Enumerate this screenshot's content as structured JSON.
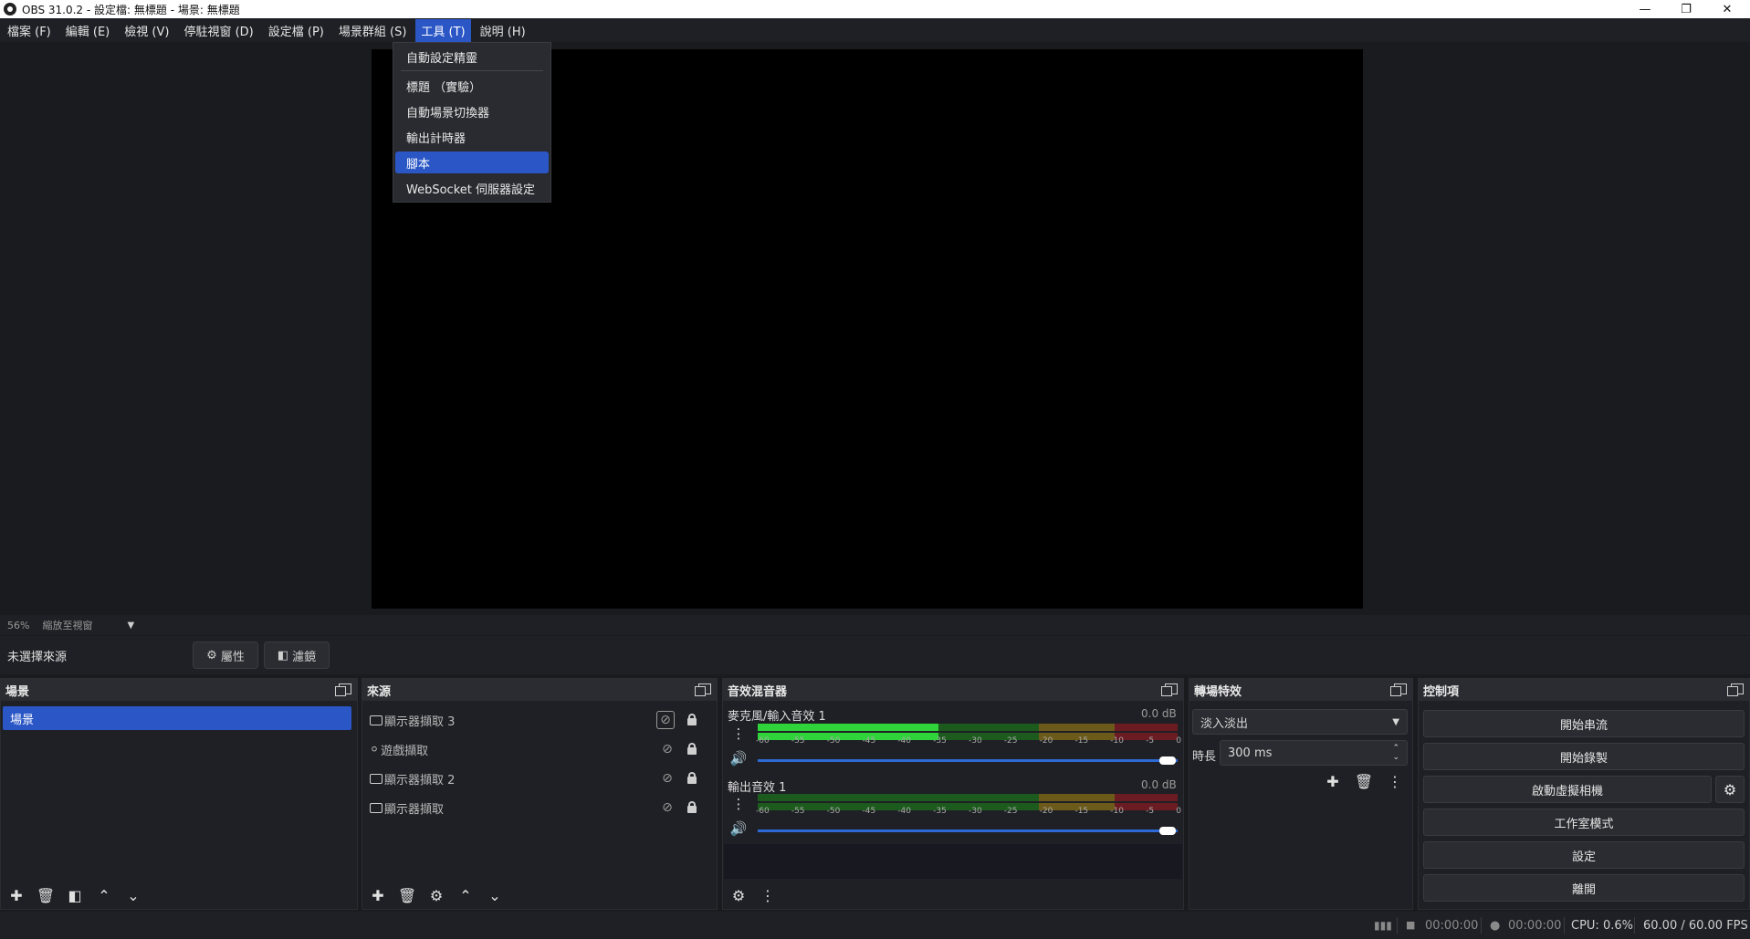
{
  "window": {
    "title": "OBS 31.0.2 - 設定檔: 無標題 - 場景: 無標題"
  },
  "menubar": [
    {
      "label": "檔案 (F)"
    },
    {
      "label": "編輯 (E)"
    },
    {
      "label": "檢視 (V)"
    },
    {
      "label": "停駐視窗 (D)"
    },
    {
      "label": "設定檔 (P)"
    },
    {
      "label": "場景群組 (S)"
    },
    {
      "label": "工具 (T)"
    },
    {
      "label": "說明 (H)"
    }
  ],
  "tools_menu": {
    "items": [
      "自動設定精靈",
      "標題 （實驗）",
      "自動場景切換器",
      "輸出計時器",
      "腳本",
      "WebSocket 伺服器設定"
    ],
    "highlighted": "腳本"
  },
  "zoom": {
    "percent": "56%",
    "mode": "縮放至視窗"
  },
  "source_toolbar": {
    "no_source": "未選擇來源",
    "properties": "屬性",
    "filters": "濾鏡"
  },
  "scenes": {
    "title": "場景",
    "items": [
      "場景"
    ]
  },
  "sources": {
    "title": "來源",
    "items": [
      "顯示器擷取 3",
      "遊戲擷取",
      "顯示器擷取 2",
      "顯示器擷取"
    ]
  },
  "mixer": {
    "title": "音效混音器",
    "channels": [
      {
        "name": "麥克風/輸入音效 1",
        "db": "0.0 dB",
        "level": 0.43
      },
      {
        "name": "輸出音效 1",
        "db": "0.0 dB",
        "level": 0.0
      }
    ],
    "ticks": [
      "-60",
      "-55",
      "-50",
      "-45",
      "-40",
      "-35",
      "-30",
      "-25",
      "-20",
      "-15",
      "-10",
      "-5",
      "0"
    ]
  },
  "transitions": {
    "title": "轉場特效",
    "selected": "淡入淡出",
    "duration_label": "時長",
    "duration_value": "300 ms"
  },
  "controls": {
    "title": "控制項",
    "buttons": [
      "開始串流",
      "開始錄製",
      "啟動虛擬相機",
      "工作室模式",
      "設定",
      "離開"
    ]
  },
  "status": {
    "stream_time": "00:00:00",
    "record_time": "00:00:00",
    "cpu": "CPU: 0.6%",
    "fps": "60.00 / 60.00 FPS"
  },
  "colors": {
    "accent": "#2a56c6",
    "background": "#1a1b1f",
    "panel": "#1f2025"
  }
}
